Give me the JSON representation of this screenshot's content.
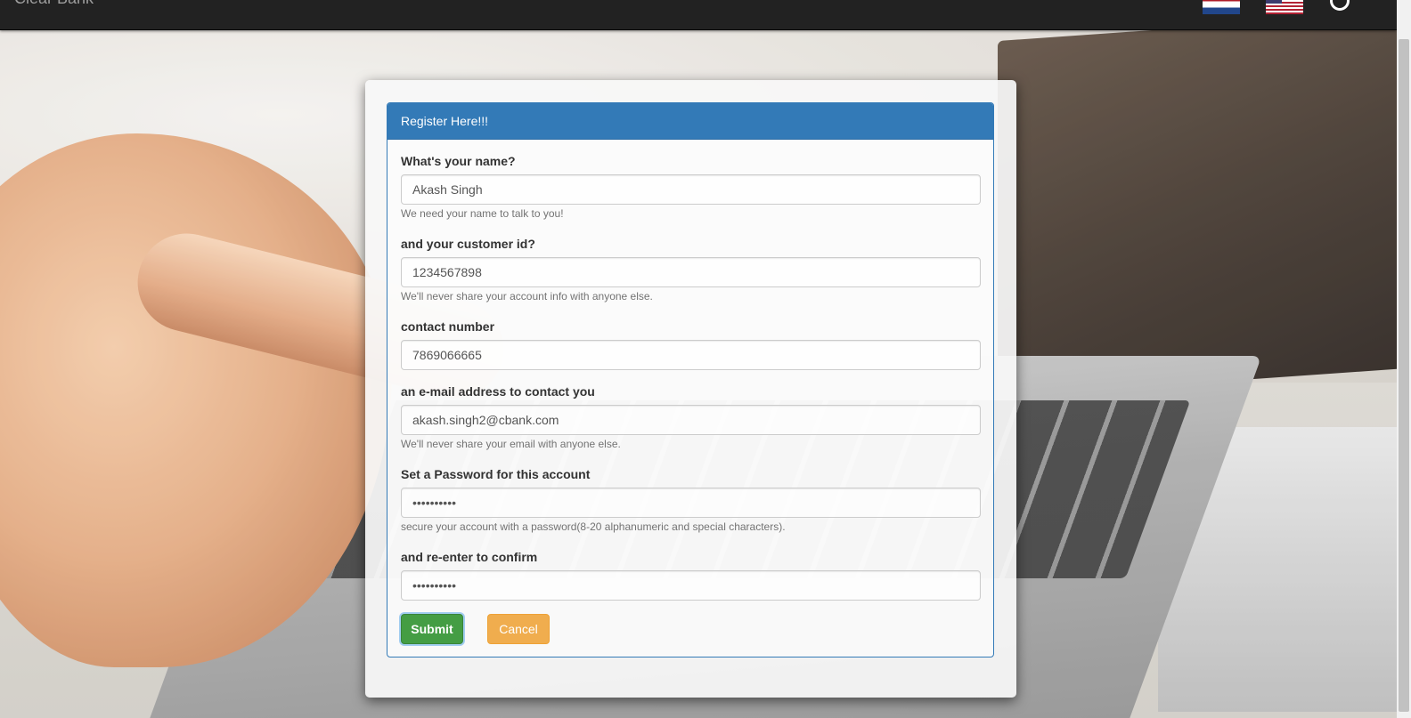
{
  "navbar": {
    "brand": "Clear Bank",
    "flags": [
      "netherlands-flag",
      "us-flag"
    ],
    "icons": [
      "power-icon"
    ]
  },
  "panel": {
    "heading": "Register Here!!!"
  },
  "form": {
    "name": {
      "label": "What's your name?",
      "value": "Akash Singh",
      "help": "We need your name to talk to you!"
    },
    "customer_id": {
      "label": "and your customer id?",
      "value": "1234567898",
      "help": "We'll never share your account info with anyone else."
    },
    "contact": {
      "label": "contact number",
      "value": "7869066665"
    },
    "email": {
      "label": "an e-mail address to contact you",
      "value": "akash.singh2@cbank.com",
      "help": "We'll never share your email with anyone else."
    },
    "password": {
      "label": "Set a Password for this account",
      "value": "••••••••••",
      "help": "secure your account with a password(8-20 alphanumeric and special characters)."
    },
    "confirm": {
      "label": "and re-enter to confirm",
      "value": "••••••••••"
    }
  },
  "buttons": {
    "submit": "Submit",
    "cancel": "Cancel"
  },
  "colors": {
    "primary": "#337ab7",
    "success": "#449d44",
    "warning": "#f0ad4e",
    "navbar": "#222222"
  }
}
